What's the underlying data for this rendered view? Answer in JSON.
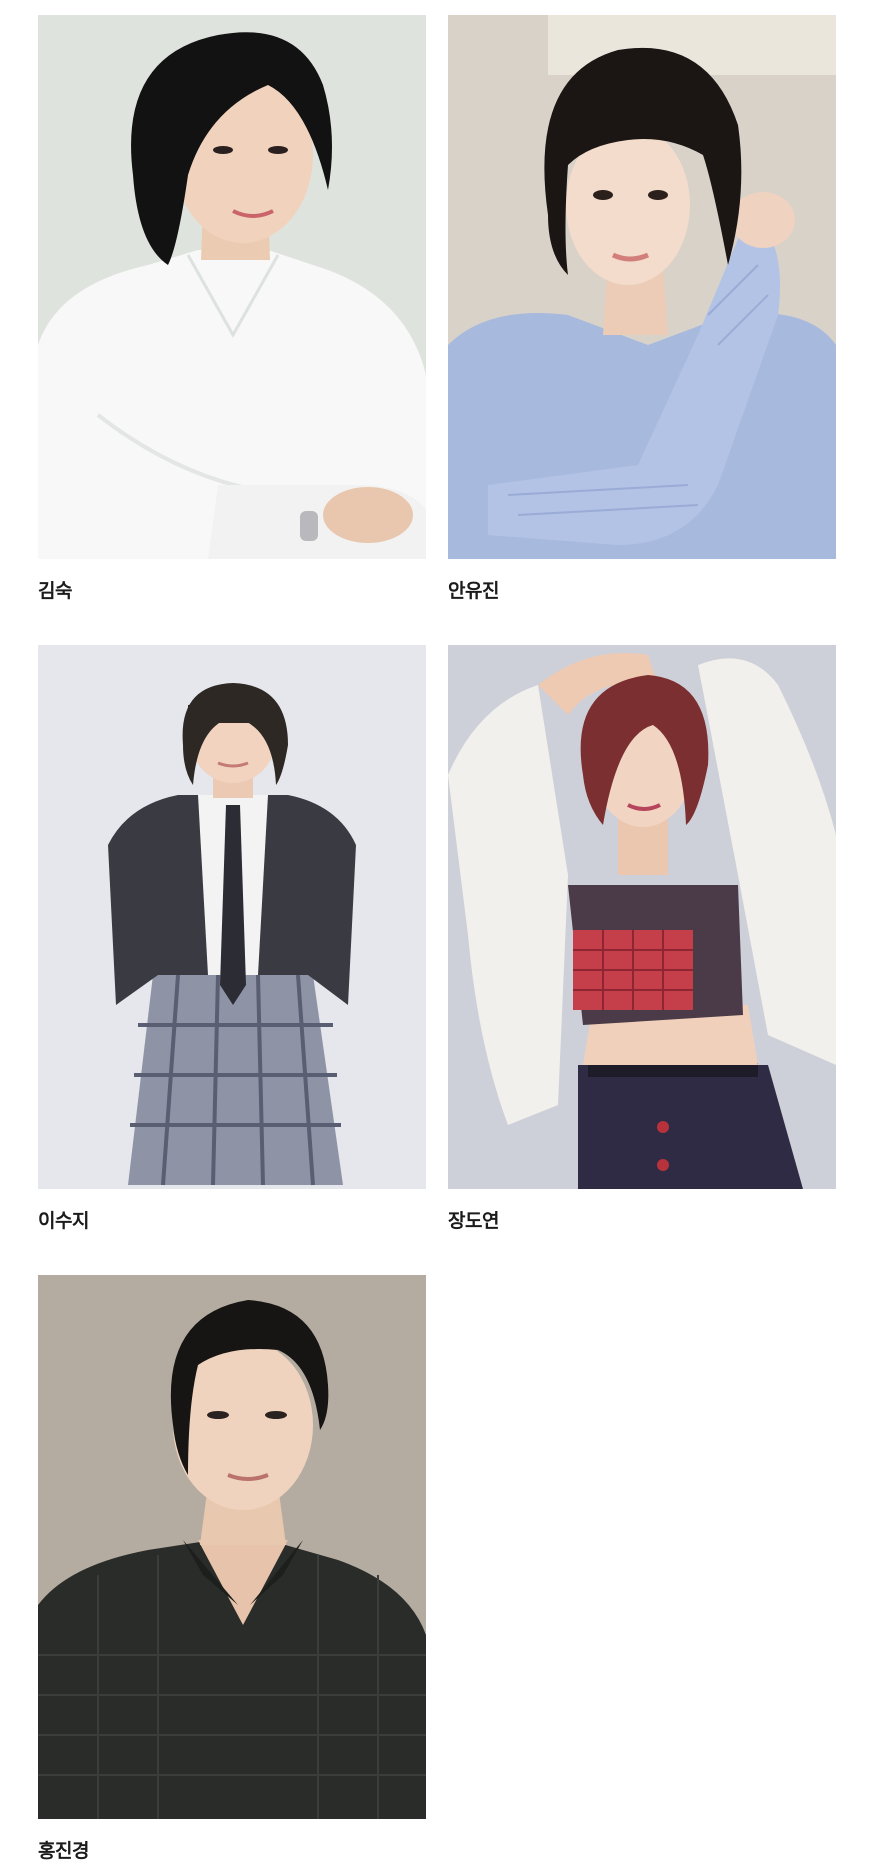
{
  "cast": [
    {
      "name": "김숙"
    },
    {
      "name": "안유진"
    },
    {
      "name": "이수지"
    },
    {
      "name": "장도연"
    },
    {
      "name": "홍진경"
    }
  ]
}
